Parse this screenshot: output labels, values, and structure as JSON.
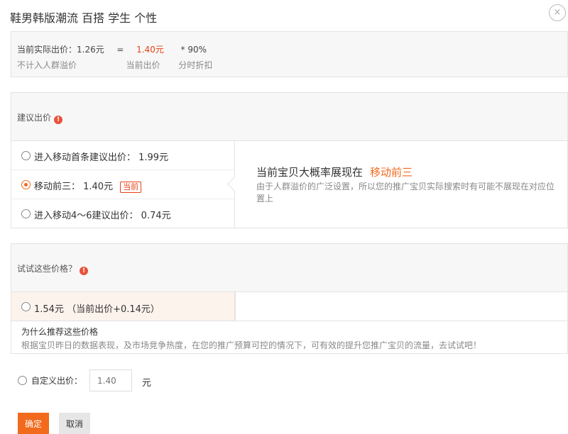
{
  "title": "鞋男韩版潮流 百搭 学生 个性",
  "close_icon": "×",
  "summary": {
    "actual_bid_label": "当前实际出价：1.26元",
    "equals": "=",
    "current_bid_value": "1.40元",
    "times": "* 90%",
    "note_crowd": "不计入人群溢价",
    "note_current": "当前出价",
    "note_discount": "分时折扣"
  },
  "suggest": {
    "heading": "建议出价",
    "info_icon": "!",
    "options": [
      {
        "label": "进入移动首条建议出价：  1.99元",
        "selected": false
      },
      {
        "label": "移动前三：  1.40元",
        "selected": true,
        "badge": "当前"
      },
      {
        "label": "进入移动4～6建议出价：  0.74元",
        "selected": false
      }
    ],
    "detail_title": "当前宝贝大概率展现在",
    "detail_highlight": "移动前三",
    "detail_desc": "由于人群溢价的广泛设置，所以您的推广宝贝实际搜索时有可能不展现在对应位置上"
  },
  "try_prices": {
    "heading": "试试这些价格？",
    "info_icon": "!",
    "option_label": "1.54元  （当前出价+0.14元）",
    "why_title": "为什么推荐这些价格",
    "why_desc": "根据宝贝昨日的数据表现，及市场竞争热度，在您的推广预算可控的情况下，可有效的提升您推广宝贝的流量，去试试吧！"
  },
  "custom": {
    "label": "自定义出价：",
    "placeholder": "1.40",
    "unit": "元"
  },
  "buttons": {
    "ok": "确定",
    "cancel": "取消"
  },
  "colors": {
    "accent": "#f26a1c",
    "red": "#e6421a"
  }
}
